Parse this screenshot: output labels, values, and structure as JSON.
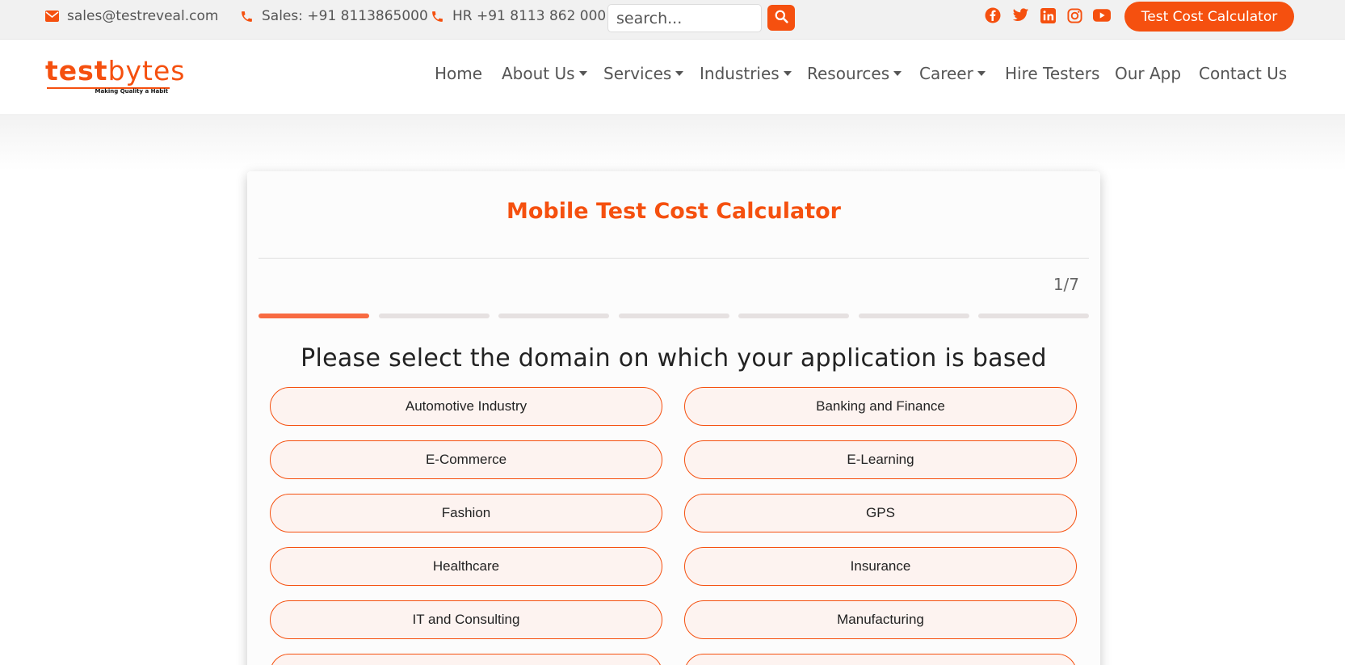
{
  "topbar": {
    "email": "sales@testreveal.com",
    "sales_phone": "Sales: +91 8113865000",
    "hr_phone": "HR +91 8113 862 000",
    "search_placeholder": "search...",
    "social": [
      "facebook-icon",
      "twitter-icon",
      "linkedin-icon",
      "instagram-icon",
      "youtube-icon"
    ],
    "cta_label": "Test Cost Calculator"
  },
  "logo": {
    "word_bold": "test",
    "word_light": "bytes",
    "tagline": "Making Quality a Habit"
  },
  "nav": {
    "items": [
      {
        "label": "Home",
        "dropdown": false
      },
      {
        "label": "About Us",
        "dropdown": true
      },
      {
        "label": "Services",
        "dropdown": true
      },
      {
        "label": "Industries",
        "dropdown": true
      },
      {
        "label": "Resources",
        "dropdown": true
      },
      {
        "label": "Career",
        "dropdown": true
      },
      {
        "label": "Hire Testers",
        "dropdown": false
      },
      {
        "label": "Our App",
        "dropdown": false
      },
      {
        "label": "Contact Us",
        "dropdown": false
      }
    ]
  },
  "calculator": {
    "title": "Mobile Test Cost Calculator",
    "step_indicator": "1/7",
    "current_step": 1,
    "total_steps": 7,
    "question": "Please select the domain on which your application is based",
    "options": [
      "Automotive Industry",
      "Banking and Finance",
      "E-Commerce",
      "E-Learning",
      "Fashion",
      "GPS",
      "Healthcare",
      "Insurance",
      "IT and Consulting",
      "Manufacturing"
    ]
  },
  "colors": {
    "accent": "#f5500f",
    "progress_active": "#f86b42",
    "progress_inactive": "#e6e1e1",
    "option_bg": "#fdf3f0"
  }
}
